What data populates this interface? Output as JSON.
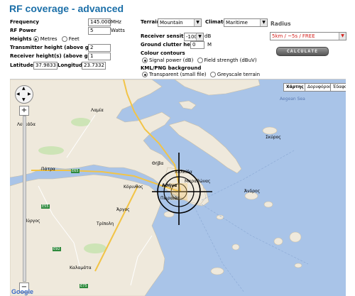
{
  "page": {
    "title": "RF coverage - advanced"
  },
  "form": {
    "frequency": {
      "label": "Frequency",
      "value": "145.000",
      "unit": "MHz"
    },
    "rf_power": {
      "label": "RF Power",
      "value": "5",
      "unit": "Watts"
    },
    "heights": {
      "label": "Heights",
      "metres": "Metres",
      "feet": "Feet",
      "selected": "metres"
    },
    "tx_height": {
      "label": "Transmitter height (above ground)",
      "value": "2"
    },
    "rx_height": {
      "label": "Receiver height(s) (above ground)",
      "value": "1"
    },
    "latitude": {
      "label": "Latitude",
      "value": "37.9833"
    },
    "longitude": {
      "label": "Longitude",
      "value": "23.7332"
    },
    "terrain": {
      "label": "Terrain",
      "value": "Mountain"
    },
    "climate": {
      "label": "Climate",
      "value": "Maritime"
    },
    "radius": {
      "label": "Radius",
      "value": "5km / ~5s / FREE"
    },
    "rx_sensitivity": {
      "label": "Receiver sensitivity",
      "value": "-100",
      "unit": "dB"
    },
    "clutter": {
      "label": "Ground clutter height",
      "value": "0",
      "unit": "M"
    },
    "colour_contours": {
      "label": "Colour contours",
      "signal": "Signal power (dB)",
      "field": "Field strength (dBuV)",
      "selected": "signal"
    },
    "kml_bg": {
      "label": "KML/PNG background",
      "transparent": "Transparent (small file)",
      "greyscale": "Greyscale terrain",
      "selected": "transparent"
    },
    "calculate_label": "CALCULATE"
  },
  "map": {
    "type_buttons": [
      "Χάρτης",
      "Δορυφόρος",
      "Έδαφος"
    ],
    "active_type": "Χάρτης",
    "places": [
      {
        "name": "Πάτρα"
      },
      {
        "name": "Χαλκίδα"
      },
      {
        "name": "Θήβα"
      },
      {
        "name": "Λαμία"
      },
      {
        "name": "Αθήνα"
      },
      {
        "name": "Μαραθώνας"
      },
      {
        "name": "Πειραιάς"
      },
      {
        "name": "Κόρινθος"
      },
      {
        "name": "Άργος"
      },
      {
        "name": "Τρίπολη"
      },
      {
        "name": "Καλαμάτα"
      },
      {
        "name": "Πύργος"
      },
      {
        "name": "Aegean Sea"
      },
      {
        "name": "Σκύρος"
      },
      {
        "name": "Άνδρος"
      },
      {
        "name": "Λευκάδα"
      }
    ],
    "road_badges": [
      "E65",
      "E55",
      "E92",
      "E75"
    ],
    "google_label": "Google",
    "zoom_in": "+",
    "zoom_out": "−"
  },
  "colors": {
    "title": "#1b6fa8",
    "radius_text": "#d4201c",
    "sea": "#a9c4e8",
    "land": "#efe9dc",
    "road": "#f2c447"
  }
}
